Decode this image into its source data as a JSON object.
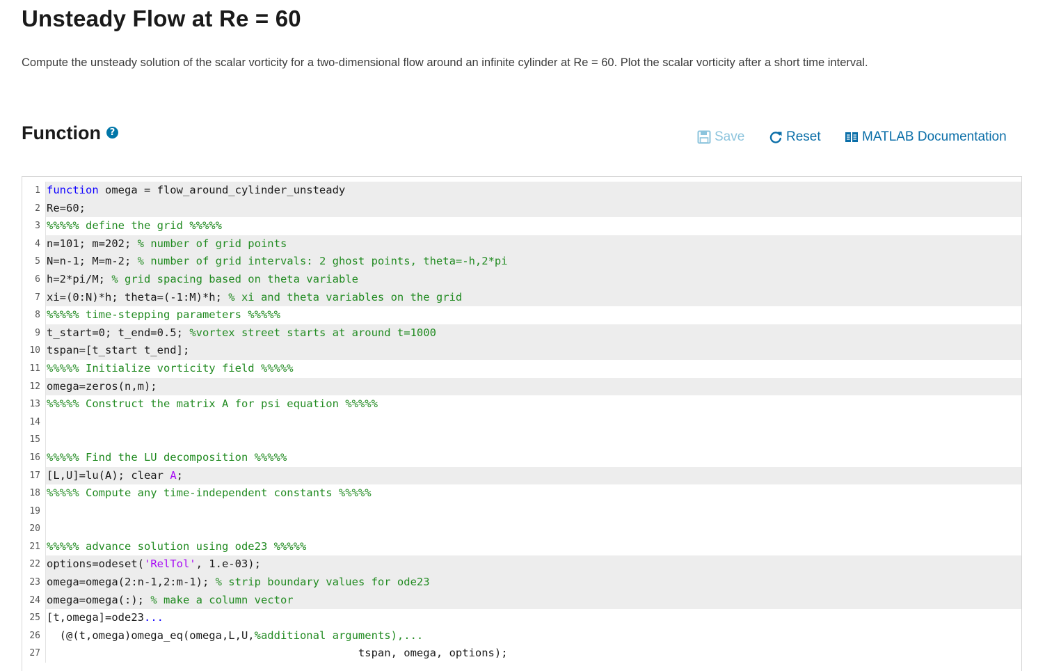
{
  "page": {
    "title": "Unsteady Flow at Re = 60",
    "description": "Compute the unsteady solution of the scalar vorticity for a two-dimensional flow around an infinite cylinder at Re = 60.  Plot the scalar vorticity after a short time interval."
  },
  "section": {
    "title": "Function",
    "help_icon_glyph": "?"
  },
  "toolbar": {
    "save_label": "Save",
    "reset_label": "Reset",
    "docs_label": "MATLAB Documentation"
  },
  "colors": {
    "keyword": "#0e00ff",
    "comment": "#228b22",
    "string": "#a709f5",
    "link": "#0a6ea8",
    "disabled_link": "#8cc4dd",
    "locked_line_bg": "#ededed"
  },
  "editor": {
    "lines": [
      {
        "n": "1",
        "locked": true,
        "tokens": [
          {
            "t": "kw",
            "v": "function"
          },
          {
            "t": "",
            "v": " omega = flow_around_cylinder_unsteady"
          }
        ]
      },
      {
        "n": "2",
        "locked": true,
        "tokens": [
          {
            "t": "",
            "v": "Re=60;"
          }
        ]
      },
      {
        "n": "3",
        "locked": false,
        "tokens": [
          {
            "t": "cm",
            "v": "%%%%% define the grid %%%%%"
          }
        ]
      },
      {
        "n": "4",
        "locked": true,
        "tokens": [
          {
            "t": "",
            "v": "n=101; m=202; "
          },
          {
            "t": "cm",
            "v": "% number of grid points"
          }
        ]
      },
      {
        "n": "5",
        "locked": true,
        "tokens": [
          {
            "t": "",
            "v": "N=n-1; M=m-2; "
          },
          {
            "t": "cm",
            "v": "% number of grid intervals: 2 ghost points, theta=-h,2*pi"
          }
        ]
      },
      {
        "n": "6",
        "locked": true,
        "tokens": [
          {
            "t": "",
            "v": "h=2*pi/M; "
          },
          {
            "t": "cm",
            "v": "% grid spacing based on theta variable"
          }
        ]
      },
      {
        "n": "7",
        "locked": true,
        "tokens": [
          {
            "t": "",
            "v": "xi=(0:N)*h; theta=(-1:M)*h; "
          },
          {
            "t": "cm",
            "v": "% xi and theta variables on the grid"
          }
        ]
      },
      {
        "n": "8",
        "locked": false,
        "tokens": [
          {
            "t": "cm",
            "v": "%%%%% time-stepping parameters %%%%%"
          }
        ]
      },
      {
        "n": "9",
        "locked": true,
        "tokens": [
          {
            "t": "",
            "v": "t_start=0; t_end=0.5; "
          },
          {
            "t": "cm",
            "v": "%vortex street starts at around t=1000"
          }
        ]
      },
      {
        "n": "10",
        "locked": true,
        "tokens": [
          {
            "t": "",
            "v": "tspan=[t_start t_end];"
          }
        ]
      },
      {
        "n": "11",
        "locked": false,
        "tokens": [
          {
            "t": "cm",
            "v": "%%%%% Initialize vorticity field %%%%%"
          }
        ]
      },
      {
        "n": "12",
        "locked": true,
        "tokens": [
          {
            "t": "",
            "v": "omega=zeros(n,m);"
          }
        ]
      },
      {
        "n": "13",
        "locked": false,
        "tokens": [
          {
            "t": "cm",
            "v": "%%%%% Construct the matrix A for psi equation %%%%%"
          }
        ]
      },
      {
        "n": "14",
        "locked": false,
        "tokens": []
      },
      {
        "n": "15",
        "locked": false,
        "tokens": []
      },
      {
        "n": "16",
        "locked": false,
        "tokens": [
          {
            "t": "cm",
            "v": "%%%%% Find the LU decomposition %%%%%"
          }
        ]
      },
      {
        "n": "17",
        "locked": true,
        "tokens": [
          {
            "t": "",
            "v": "[L,U]=lu(A); clear "
          },
          {
            "t": "str",
            "v": "A"
          },
          {
            "t": "",
            "v": ";"
          }
        ]
      },
      {
        "n": "18",
        "locked": false,
        "tokens": [
          {
            "t": "cm",
            "v": "%%%%% Compute any time-independent constants %%%%%"
          }
        ]
      },
      {
        "n": "19",
        "locked": false,
        "tokens": []
      },
      {
        "n": "20",
        "locked": false,
        "tokens": []
      },
      {
        "n": "21",
        "locked": false,
        "tokens": [
          {
            "t": "cm",
            "v": "%%%%% advance solution using ode23 %%%%%"
          }
        ]
      },
      {
        "n": "22",
        "locked": true,
        "tokens": [
          {
            "t": "",
            "v": "options=odeset("
          },
          {
            "t": "str",
            "v": "'RelTol'"
          },
          {
            "t": "",
            "v": ", 1.e-03);"
          }
        ]
      },
      {
        "n": "23",
        "locked": true,
        "tokens": [
          {
            "t": "",
            "v": "omega=omega(2:n-1,2:m-1); "
          },
          {
            "t": "cm",
            "v": "% strip boundary values for ode23"
          }
        ]
      },
      {
        "n": "24",
        "locked": true,
        "tokens": [
          {
            "t": "",
            "v": "omega=omega(:); "
          },
          {
            "t": "cm",
            "v": "% make a column vector"
          }
        ]
      },
      {
        "n": "25",
        "locked": false,
        "tokens": [
          {
            "t": "",
            "v": "[t,omega]=ode23"
          },
          {
            "t": "kw",
            "v": "..."
          }
        ]
      },
      {
        "n": "26",
        "locked": false,
        "tokens": [
          {
            "t": "",
            "v": "  (@(t,omega)omega_eq(omega,L,U,"
          },
          {
            "t": "cm",
            "v": "%additional arguments),..."
          }
        ]
      },
      {
        "n": "27",
        "locked": false,
        "tokens": [
          {
            "t": "",
            "v": "                                                tspan, omega, options);"
          }
        ]
      }
    ]
  }
}
